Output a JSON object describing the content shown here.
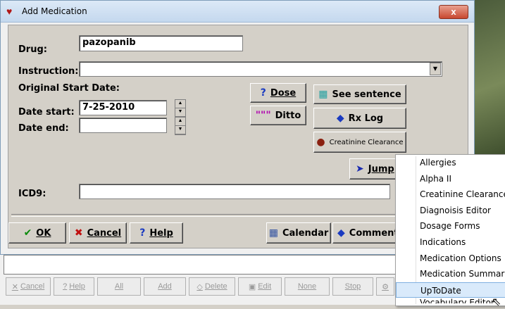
{
  "window": {
    "title": "Add Medication",
    "close_label": "x"
  },
  "form": {
    "drug_label": "Drug:",
    "drug_value": "pazopanib",
    "instruction_label": "Instruction:",
    "original_start_label": "Original Start Date:",
    "date_start_label": "Date start:",
    "date_start_value": "7-25-2010",
    "date_end_label": "Date end:",
    "date_end_value": "",
    "icd9_label": "ICD9:",
    "icd9_value": ""
  },
  "buttons": {
    "dose": "Dose",
    "ditto": "Ditto",
    "see_sentence": "See sentence",
    "rx_log": "Rx Log",
    "creatinine": "Creatinine Clearance",
    "jump": "Jump",
    "ok": "OK",
    "cancel": "Cancel",
    "help": "Help",
    "calendar": "Calendar",
    "comment": "Comment"
  },
  "toolbar": {
    "cancel": "Cancel",
    "help": "Help",
    "all": "All",
    "add": "Add",
    "delete": "Delete",
    "edit": "Edit",
    "none": "None",
    "stop": "Stop"
  },
  "jump_menu": {
    "items": [
      "Allergies",
      "Alpha II",
      "Creatinine Clearance",
      "Diagnoisis Editor",
      "Dosage Forms",
      "Indications",
      "Medication Options",
      "Medication Summary",
      "UpToDate",
      "Vocabulary Editor"
    ],
    "highlighted": "UpToDate"
  }
}
